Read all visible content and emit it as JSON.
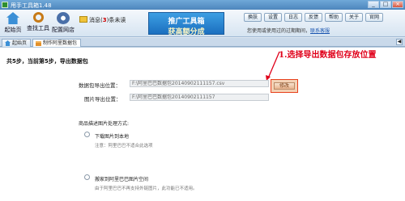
{
  "window": {
    "title": "甩手工具箱1.48",
    "buttons": [
      "_",
      "□",
      "×"
    ]
  },
  "toolbar": {
    "tools": [
      {
        "label": "起始页",
        "icon": "home-icon"
      },
      {
        "label": "查找工具",
        "icon": "search-icon"
      },
      {
        "label": "配置网店",
        "icon": "gear-icon"
      }
    ],
    "message": {
      "prefix": "消息(",
      "count": "3",
      "suffix": ")条未读"
    },
    "ad": {
      "line1": "推广工具箱",
      "line2": "获高额分成"
    },
    "top_buttons": [
      "换肤",
      "设置",
      "日志",
      "反馈",
      "帮助",
      "关于",
      "官网"
    ],
    "notice": {
      "text": "您使用或使用过的过期期间，",
      "link": "联系客服"
    }
  },
  "tabs": [
    {
      "label": "起始页",
      "active": false
    },
    {
      "label": "制作阿里数据包",
      "active": true
    }
  ],
  "content": {
    "step": "共5步，当前第5步，导出数据包",
    "annotation": "1.选择导出数据包存放位置",
    "fields": [
      {
        "label": "数据包导出位置：",
        "value": "F:\\阿里巴巴数据包20140902111157.csv"
      },
      {
        "label": "图片导出位置：",
        "value": "F:\\阿里巴巴数据包20140902111157"
      }
    ],
    "modify_label": "修改",
    "image_section_title": "商品描述图片处理方式:",
    "options": [
      {
        "label": "下载图片到本地",
        "note": "注意：阿里巴巴不适合此选项"
      },
      {
        "label": "搬家到阿里巴巴图片空间",
        "note": "由于阿里巴巴不再支持外链图片，此功能已不适用。"
      }
    ]
  }
}
